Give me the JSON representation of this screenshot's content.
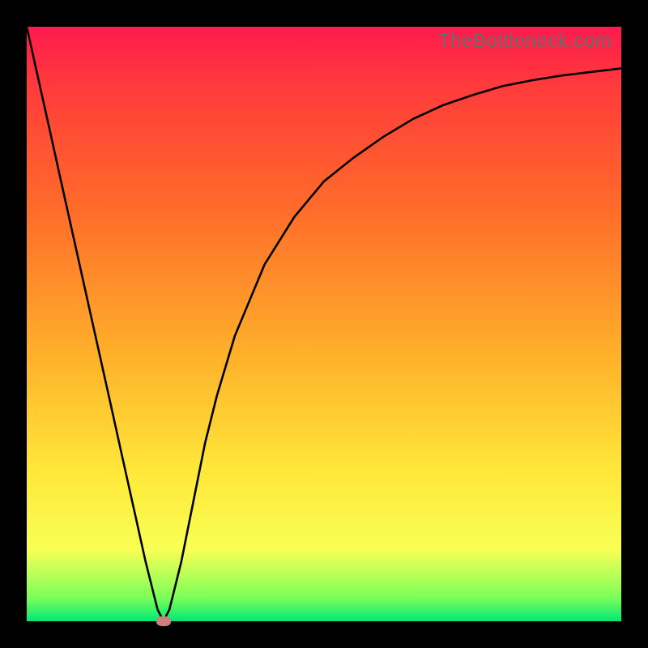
{
  "attribution": "TheBottleneck.com",
  "colors": {
    "page_bg": "#000000",
    "gradient_top": "#ff1a4d",
    "gradient_bottom": "#00e874",
    "curve": "#000000",
    "marker": "#cf7e7c",
    "attribution_text": "#6b6b6b"
  },
  "chart_data": {
    "type": "line",
    "title": "",
    "xlabel": "",
    "ylabel": "",
    "xlim": [
      0,
      100
    ],
    "ylim": [
      0,
      100
    ],
    "x": [
      0,
      2,
      4,
      6,
      8,
      10,
      12,
      14,
      16,
      18,
      20,
      22,
      23,
      24,
      26,
      28,
      30,
      32,
      35,
      40,
      45,
      50,
      55,
      60,
      65,
      70,
      75,
      80,
      85,
      90,
      95,
      100
    ],
    "values": [
      100,
      91,
      82,
      73,
      64,
      55,
      46,
      37,
      28,
      19,
      10,
      2,
      0,
      2,
      10,
      20,
      30,
      38,
      48,
      60,
      68,
      74,
      78,
      81.5,
      84.5,
      86.8,
      88.5,
      90,
      91,
      91.8,
      92.4,
      93
    ],
    "marker": {
      "x": 23,
      "y": 0
    },
    "grid": false,
    "legend": false
  }
}
